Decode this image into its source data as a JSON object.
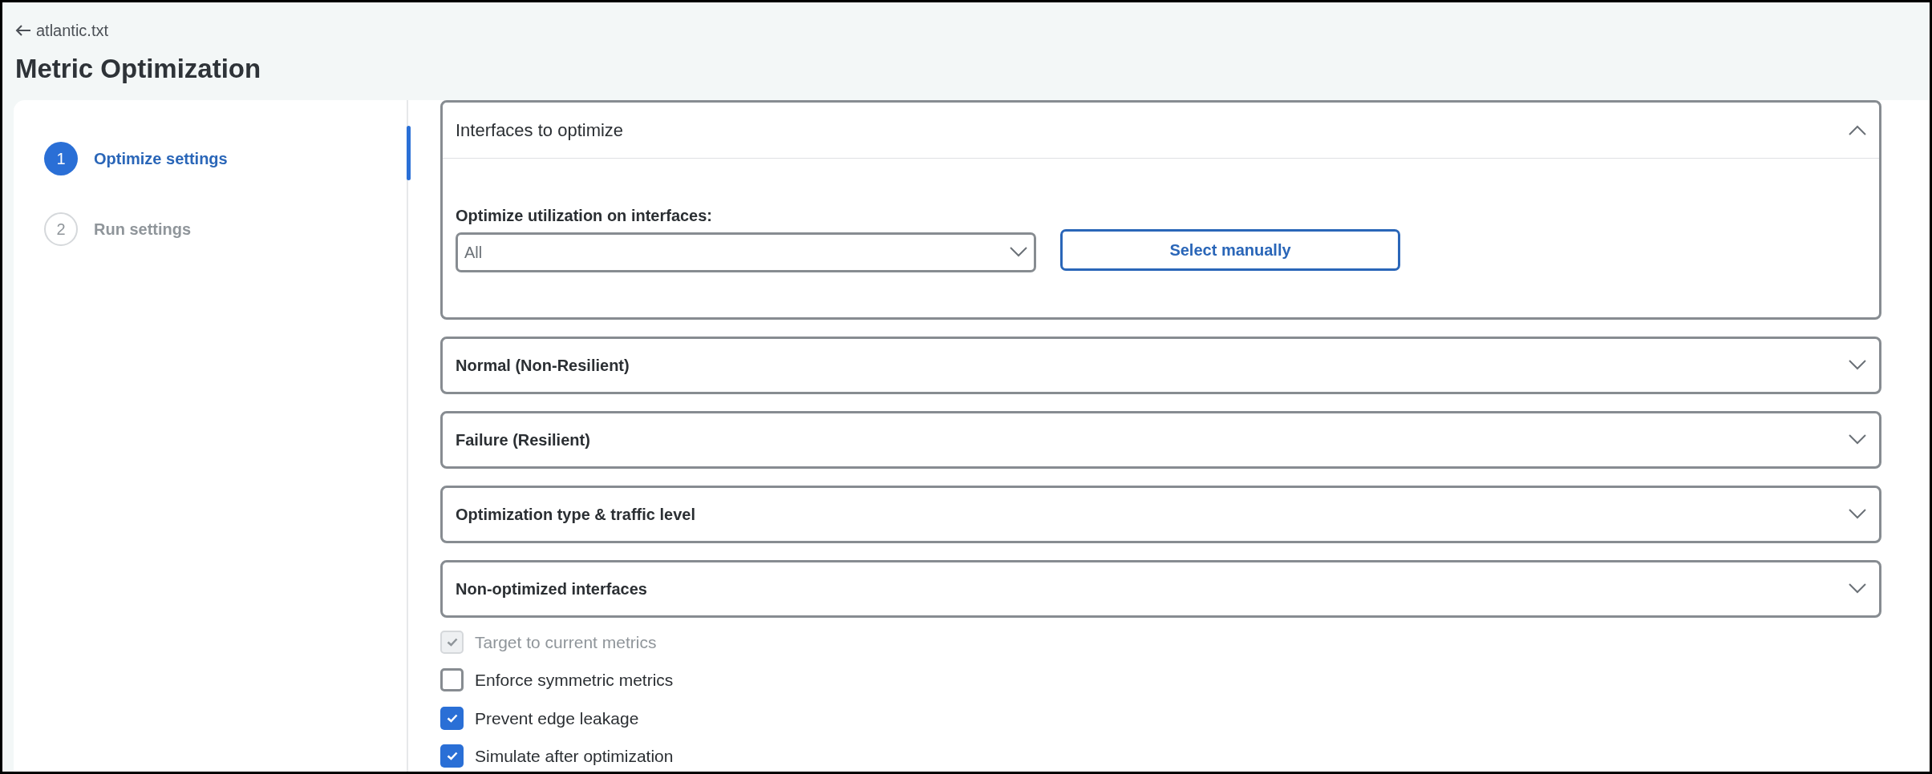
{
  "back_link": {
    "label": "atlantic.txt"
  },
  "title": "Metric Optimization",
  "steps": [
    {
      "number": "1",
      "label": "Optimize settings",
      "selected": true
    },
    {
      "number": "2",
      "label": "Run settings",
      "selected": false
    }
  ],
  "sections": [
    {
      "title": "Interfaces to optimize",
      "expanded": true,
      "field_label": "Optimize utilization on interfaces:",
      "select_value": "All",
      "button": "Select manually"
    },
    {
      "title": "Normal (Non-Resilient)",
      "expanded": false
    },
    {
      "title": "Failure (Resilient)",
      "expanded": false
    },
    {
      "title": "Optimization type & traffic level",
      "expanded": false
    },
    {
      "title": "Non-optimized interfaces",
      "expanded": false
    }
  ],
  "options": [
    {
      "label": "Target to current metrics",
      "checked": true,
      "disabled": true
    },
    {
      "label": "Enforce symmetric metrics",
      "checked": false,
      "disabled": false
    },
    {
      "label": "Prevent edge leakage",
      "checked": true,
      "disabled": false
    },
    {
      "label": "Simulate after optimization",
      "checked": true,
      "disabled": false
    }
  ]
}
